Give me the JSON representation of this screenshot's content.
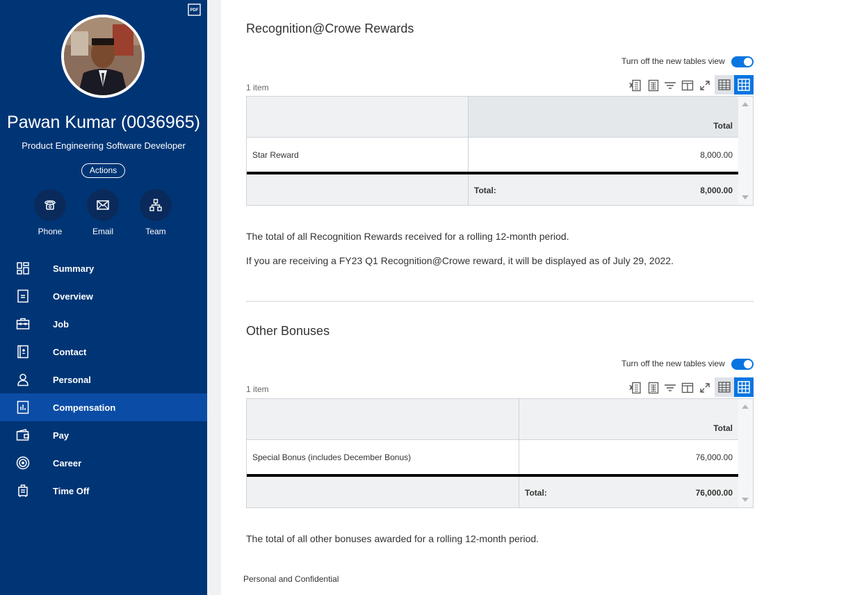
{
  "sidebar": {
    "pdf_label": "PDF",
    "name": "Pawan Kumar (0036965)",
    "role": "Product Engineering Software Developer",
    "actions_label": "Actions",
    "quick_actions": [
      {
        "label": "Phone",
        "icon": "phone-icon"
      },
      {
        "label": "Email",
        "icon": "email-icon"
      },
      {
        "label": "Team",
        "icon": "team-icon"
      }
    ],
    "nav": [
      {
        "label": "Summary",
        "icon": "summary-icon"
      },
      {
        "label": "Overview",
        "icon": "overview-icon"
      },
      {
        "label": "Job",
        "icon": "job-icon"
      },
      {
        "label": "Contact",
        "icon": "contact-icon"
      },
      {
        "label": "Personal",
        "icon": "personal-icon"
      },
      {
        "label": "Compensation",
        "icon": "compensation-icon",
        "active": true
      },
      {
        "label": "Pay",
        "icon": "pay-icon"
      },
      {
        "label": "Career",
        "icon": "career-icon"
      },
      {
        "label": "Time Off",
        "icon": "time-off-icon"
      }
    ]
  },
  "rewards": {
    "title": "Recognition@Crowe Rewards",
    "toggle_label": "Turn off the new tables view",
    "count": "1 item",
    "column_header": "Total",
    "row_label": "Star Reward",
    "row_value": "8,000.00",
    "total_label": "Total:",
    "total_value": "8,000.00",
    "para1": "The total of all Recognition Rewards received for a rolling 12-month period.",
    "para2": "If you are receiving a FY23 Q1 Recognition@Crowe reward, it will be displayed as of July 29, 2022."
  },
  "bonuses": {
    "title": "Other Bonuses",
    "toggle_label": "Turn off the new tables view",
    "count": "1 item",
    "column_header": "Total",
    "row_label": "Special Bonus (includes December Bonus)",
    "row_value": "76,000.00",
    "total_label": "Total:",
    "total_value": "76,000.00",
    "para1": "The total of all other bonuses awarded for a rolling 12-month period."
  },
  "footer": "Personal and Confidential",
  "colors": {
    "sidebar_bg": "#003575",
    "active_nav": "#0b4da6",
    "accent": "#0875e1"
  }
}
